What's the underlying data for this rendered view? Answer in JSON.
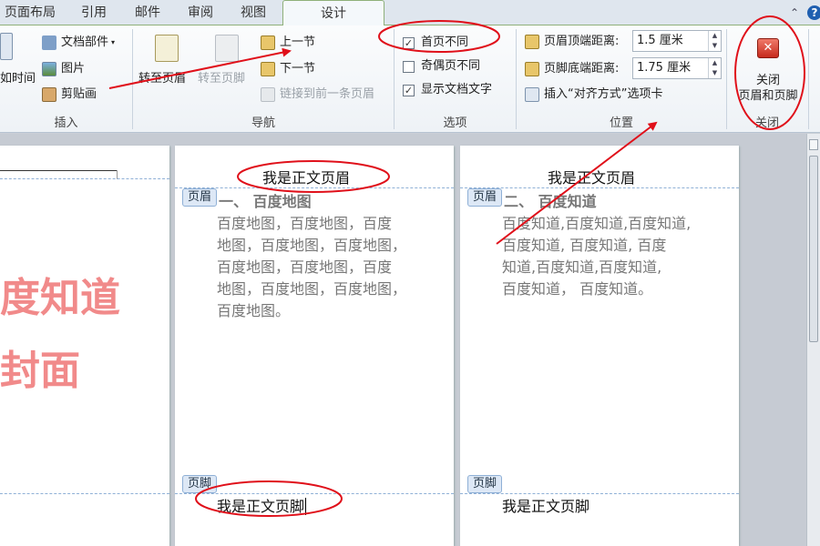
{
  "tabs": [
    "页面布局",
    "引用",
    "邮件",
    "审阅",
    "视图",
    "设计"
  ],
  "ribbon": {
    "insert": {
      "label": "插入",
      "datetime_partial": "如时间",
      "doc_parts": "文档部件",
      "picture": "图片",
      "clipart": "剪贴画"
    },
    "nav": {
      "label": "导航",
      "goto_header": "转至页眉",
      "goto_footer": "转至页脚",
      "prev_section": "上一节",
      "next_section": "下一节",
      "link_previous": "链接到前一条页眉"
    },
    "options": {
      "label": "选项",
      "first_page_diff": "首页不同",
      "odd_even_diff": "奇偶页不同",
      "show_doc_text": "显示文档文字"
    },
    "position": {
      "label": "位置",
      "header_top_label": "页眉顶端距离:",
      "header_top_value": "1.5 厘米",
      "footer_bottom_label": "页脚底端距离:",
      "footer_bottom_value": "1.75 厘米",
      "insert_align_tab": "插入“对齐方式”选项卡"
    },
    "close": {
      "label": "关闭",
      "btn_line1": "关闭",
      "btn_line2": "页眉和页脚"
    }
  },
  "pages": {
    "cover": {
      "line1": "度知道",
      "line2": "封面"
    },
    "page2": {
      "header_tag": "页眉",
      "header_text": "我是正文页眉",
      "heading": "一、 百度地图",
      "body_lines": [
        "百度地图，百度地图，百度",
        "地图，百度地图，百度地图，",
        "百度地图，百度地图，百度",
        "地图，百度地图，百度地图，",
        "百度地图。"
      ],
      "footer_tag": "页脚",
      "footer_text": "我是正文页脚"
    },
    "page3": {
      "header_tag": "页眉",
      "header_text": "我是正文页眉",
      "heading": "二、 百度知道",
      "body_lines": [
        "百度知道,百度知道,百度知道,",
        "百度知道, 百度知道, 百度",
        "知道,百度知道,百度知道,",
        "百度知道， 百度知道。"
      ],
      "footer_tag": "页脚",
      "footer_text": "我是正文页脚"
    }
  },
  "colors": {
    "annotation": "#e0101a",
    "cover_text": "#f18a8a",
    "dashed_line": "#8fb0d6"
  }
}
